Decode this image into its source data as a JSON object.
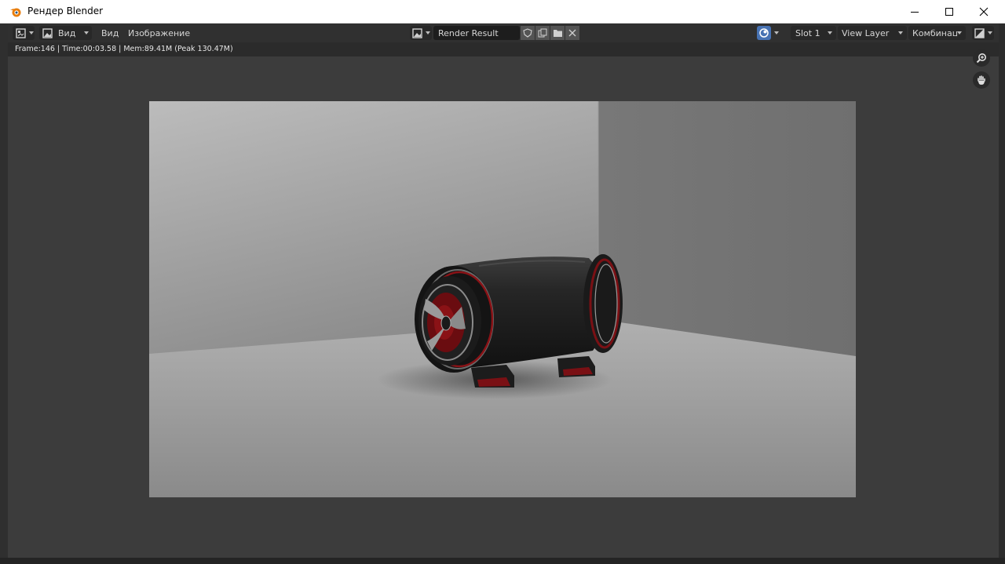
{
  "window": {
    "title": "Рендер Blender",
    "controls": [
      "minimize",
      "maximize",
      "close"
    ]
  },
  "header": {
    "view_dropdown": "Вид",
    "menus": [
      "Вид",
      "Изображение"
    ],
    "image_name": "Render Result",
    "slot": "Slot 1",
    "view_layer": "View Layer",
    "pass": "Комбинац..."
  },
  "info": {
    "text": "Frame:146 | Time:00:03.58 | Mem:89.41M (Peak 130.47M)"
  },
  "icons": {
    "editor_type": "image-editor-icon",
    "mode": "view-mode-icon",
    "browse": "image-browse-icon",
    "fake_user": "shield-icon",
    "duplicate": "duplicate-icon",
    "open": "folder-icon",
    "unlink": "close-icon",
    "engine": "render-engine-icon",
    "display": "display-channels-icon",
    "zoom": "zoom-icon",
    "pan": "hand-icon"
  },
  "colors": {
    "title_bar": "#ffffff",
    "header_bg": "#303030",
    "viewport_bg": "#3c3c3c",
    "accent": "#4772b3",
    "speaker_accent": "#8a1216"
  }
}
